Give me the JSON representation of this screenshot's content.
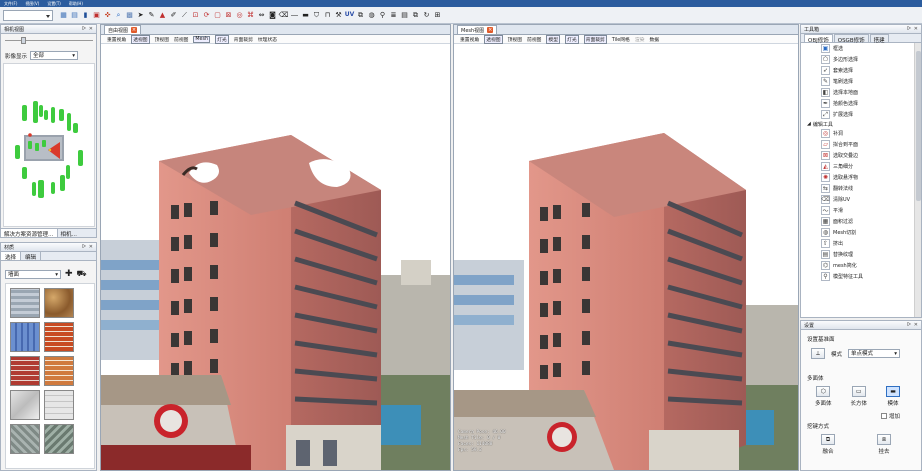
{
  "menu": [
    "文件(F)",
    "视图(V)",
    "设置(T)",
    "帮助(H)"
  ],
  "left_panel": {
    "title": "相机视图",
    "filter_label": "影像显示",
    "filter_value": "全部",
    "tabs": [
      "解决方案资源管理…",
      "相机…"
    ]
  },
  "material_panel": {
    "title": "材质",
    "tabs": [
      "选择",
      "编辑"
    ],
    "category_value": "墙面"
  },
  "view1": {
    "tab_label": "自由视图",
    "menu": [
      "重置视角",
      "透视图",
      "顶视图",
      "前视图",
      "Mesh",
      "灯光",
      "背面裁剪",
      "纹理状态"
    ]
  },
  "view2": {
    "tab_label": "Mesh视图",
    "menu": [
      "重置视角",
      "透视图",
      "顶视图",
      "前视图",
      "模型",
      "灯光",
      "背面裁剪",
      "Tile网格",
      "渲染",
      "数据"
    ]
  },
  "toolbox": {
    "title": "工具箱",
    "tabs": [
      "OBJ修饰",
      "OSGB修饰",
      "搭建"
    ],
    "select_items": [
      "框选",
      "多边形选择",
      "套索选择",
      "笔刷选择",
      "选择本地面",
      "拾颜色选择",
      "扩展选择"
    ],
    "section_label": "编辑工具",
    "edit_items": [
      "补洞",
      "拟合到平面",
      "选取交叠边",
      "三角细分",
      "选取悬浮物",
      "翻转法线",
      "清除UV",
      "平滑",
      "面积过滤",
      "Mesh切割",
      "挤出",
      "替换纹理",
      "mesh简化",
      "模型特征工具"
    ]
  },
  "settings": {
    "title": "设置",
    "section1": "设置基准面",
    "mode_label": "模式",
    "mode_value": "单点模式",
    "section2": "多面体",
    "shapes": [
      "多面体",
      "长方体",
      "模体"
    ],
    "checkbox_label": "增加",
    "section3": "挖键方式",
    "cut_buttons": [
      "融合",
      "挂去"
    ]
  },
  "overlay_text": [
    "Camera Pose: 46.00",
    "Mesh Tile: 0 / 0",
    "Faces: 114088",
    "Fps: 59.2"
  ]
}
